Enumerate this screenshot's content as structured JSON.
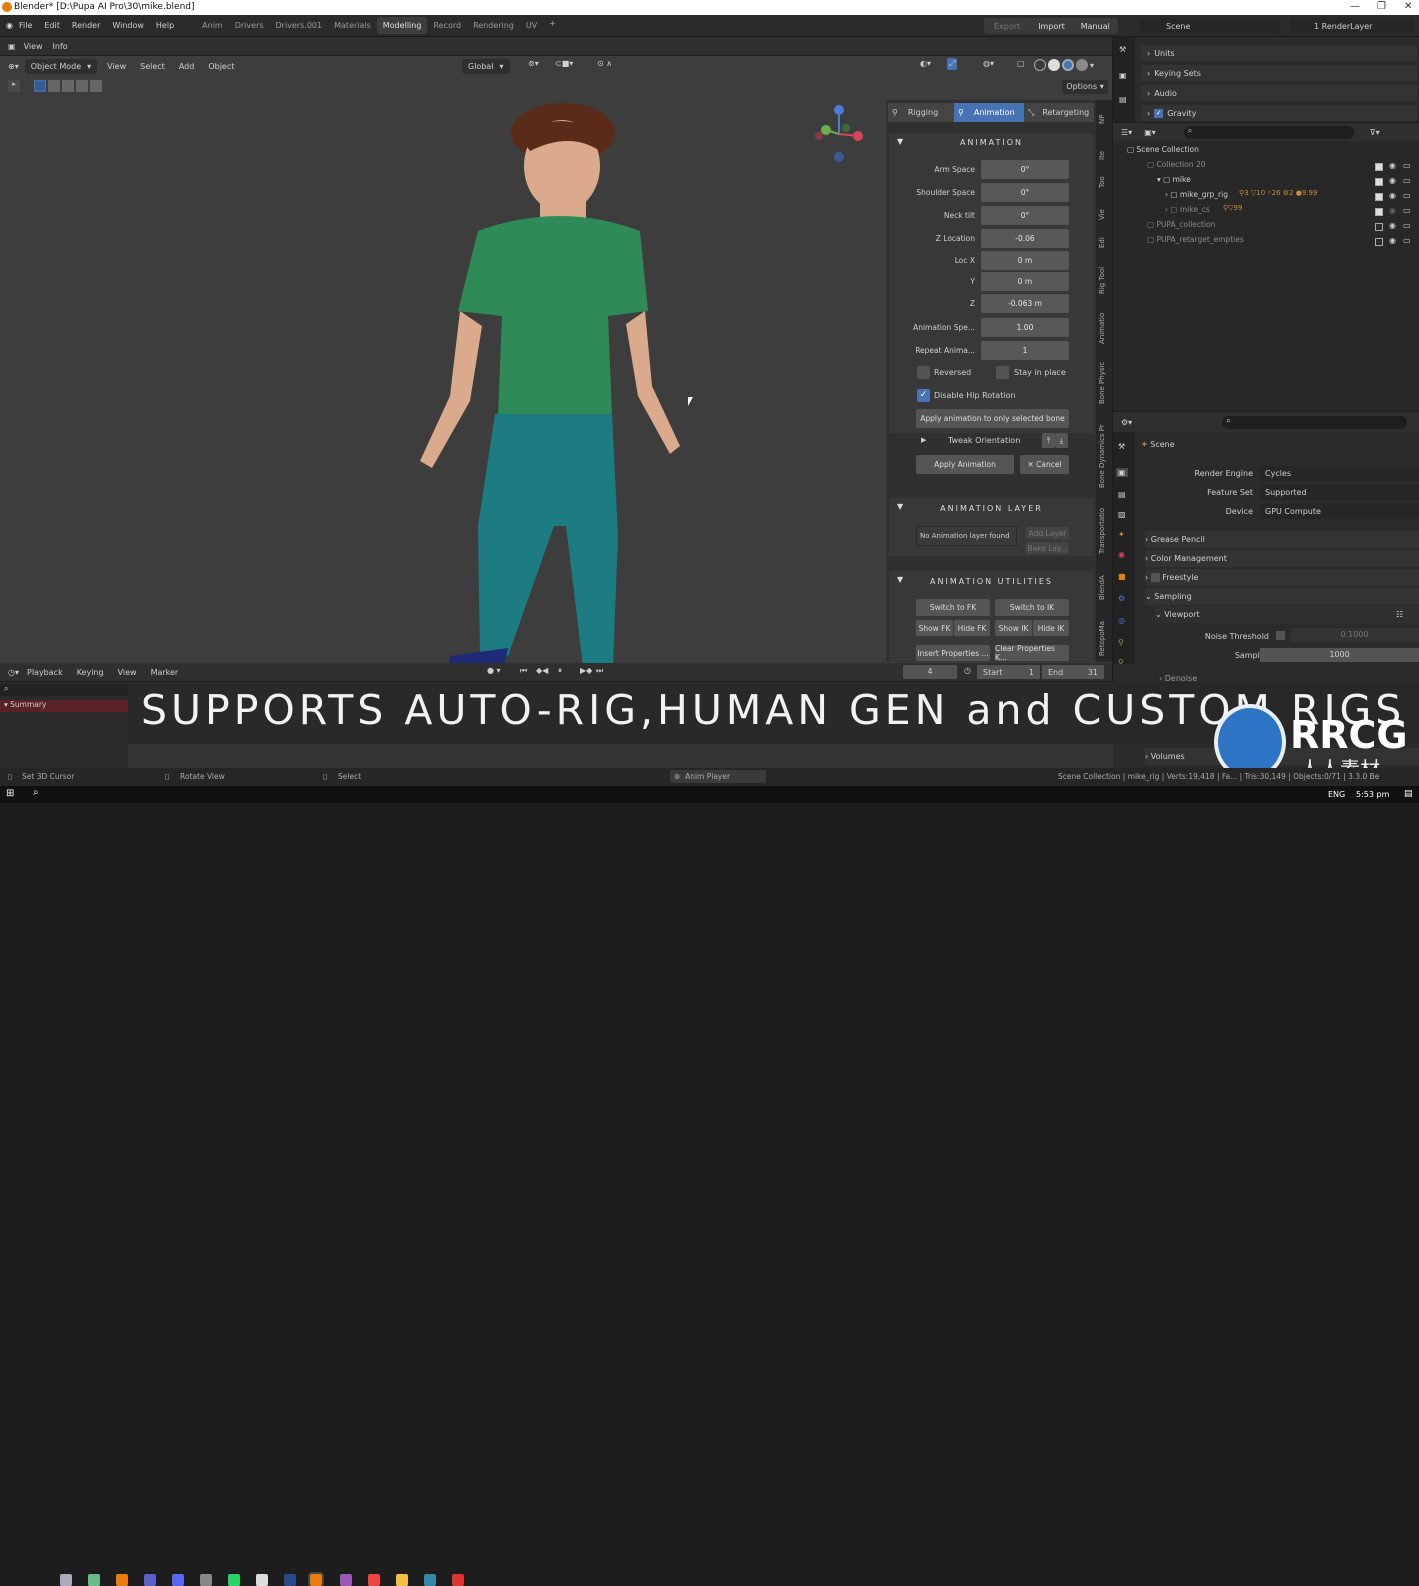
{
  "window": {
    "title": "Blender* [D:\\Pupa AI Pro\\30\\mike.blend]"
  },
  "menubar": {
    "menus": [
      "File",
      "Edit",
      "Render",
      "Window",
      "Help"
    ],
    "workspaces": [
      "Anim",
      "Drivers",
      "Drivers.001",
      "Materials",
      "Modelling",
      "Record",
      "Rendering",
      "UV"
    ],
    "active_workspace": "Modelling",
    "add_tab": "+",
    "export": "Export",
    "import": "Import",
    "manual": "Manual",
    "scene": "Scene",
    "render_layer": "1 RenderLayer"
  },
  "info_header": {
    "view": "View",
    "info": "Info"
  },
  "viewport_header": {
    "mode": "Object Mode",
    "menus": [
      "View",
      "Select",
      "Add",
      "Object"
    ],
    "transform": "Global",
    "options": "Options"
  },
  "npanel": {
    "tabs": [
      "Rigging",
      "Animation",
      "Retargeting"
    ],
    "active_tab": "Animation",
    "animation": {
      "title": "ANIMATION",
      "fields": [
        {
          "label": "Arm Space",
          "value": "0°"
        },
        {
          "label": "Shoulder Space",
          "value": "0°"
        },
        {
          "label": "Neck tilt",
          "value": "0°"
        },
        {
          "label": "Z Location",
          "value": "-0.06"
        },
        {
          "label": "Loc X",
          "value": "0 m"
        },
        {
          "label": "Y",
          "value": "0 m"
        },
        {
          "label": "Z",
          "value": "-0.063 m"
        },
        {
          "label": "Animation Spe...",
          "value": "1.00"
        },
        {
          "label": "Repeat Anima...",
          "value": "1"
        }
      ],
      "reversed": "Reversed",
      "stay_in_place": "Stay in place",
      "disable_hip": "Disable Hip Rotation",
      "apply_selected": "Apply animation to only selected bone",
      "tweak": "Tweak Orientation",
      "apply": "Apply Animation",
      "cancel": "Cancel"
    },
    "layer": {
      "title": "ANIMATION LAYER",
      "none": "No Animation layer found",
      "add": "Add Layer",
      "bake": "Bake Lay..."
    },
    "utilities": {
      "title": "ANIMATION UTILITIES",
      "switch_fk": "Switch to FK",
      "switch_ik": "Switch to IK",
      "show_fk": "Show FK",
      "hide_fk": "Hide FK",
      "show_ik": "Show IK",
      "hide_ik": "Hide IK",
      "insert": "Insert Properties ...",
      "clear": "Clear Properties K..."
    },
    "vertical_tabs": [
      "Bone Dynamics Pr",
      "Bone Physic",
      "Animatio",
      "Rig Tool",
      "Edi",
      "Vie",
      "Too",
      "Ite",
      "NP"
    ],
    "vertical_tabs_lower": [
      "BlendA",
      "Transportatio",
      "RetopoMa"
    ]
  },
  "top_props": {
    "items": [
      "Units",
      "Keying Sets",
      "Audio",
      "Gravity"
    ]
  },
  "outliner": {
    "root": "Scene Collection",
    "items": [
      {
        "name": "Collection 20",
        "dim": true
      },
      {
        "name": "mike",
        "dim": false
      },
      {
        "name": "mike_grp_rig",
        "dim": false
      },
      {
        "name": "mike_cs",
        "dim": true
      },
      {
        "name": "PUPA_collection",
        "dim": true
      },
      {
        "name": "PUPA_retarget_empties",
        "dim": true
      }
    ],
    "badges": [
      "3",
      "10",
      "26",
      "2",
      "9.99",
      "99"
    ]
  },
  "properties": {
    "scene": "Scene",
    "render_engine_label": "Render Engine",
    "render_engine": "Cycles",
    "feature_set_label": "Feature Set",
    "feature_set": "Supported",
    "device_label": "Device",
    "device": "GPU Compute",
    "groups": [
      "Grease Pencil",
      "Color Management",
      "Freestyle",
      "Sampling",
      "Viewport"
    ],
    "noise_threshold_label": "Noise Threshold",
    "noise_threshold": "0.1000",
    "samples_label": "Samples",
    "samples": "1000",
    "denoise": "Denoise",
    "volumes": "Volumes"
  },
  "timeline": {
    "menus": [
      "Playback",
      "Keying",
      "View",
      "Marker"
    ],
    "frame": "4",
    "start_label": "Start",
    "start": "1",
    "end_label": "End",
    "end": "31"
  },
  "dopesheet": {
    "summary": "Summary"
  },
  "banner": "SUPPORTS AUTO-RIG,HUMAN GEN and CUSTOM RIGS",
  "statusbar": {
    "cursor": "Set 3D Cursor",
    "rotate": "Rotate View",
    "select": "Select",
    "anim_player": "Anim Player",
    "stats": "Scene Collection | mike_rig | Verts:19,418 | Fa... | Tris:30,149 | Objects:0/71 | 3.3.0 Be"
  },
  "watermark": {
    "brand": "RRCG",
    "sub": "人人素材"
  },
  "taskbar": {
    "lang": "ENG",
    "time": "5:53 pm"
  },
  "colors": {
    "accent": "#4772b3",
    "shirt": "#2e8a56",
    "jeans": "#1d7c82",
    "skin": "#d8a98a"
  }
}
